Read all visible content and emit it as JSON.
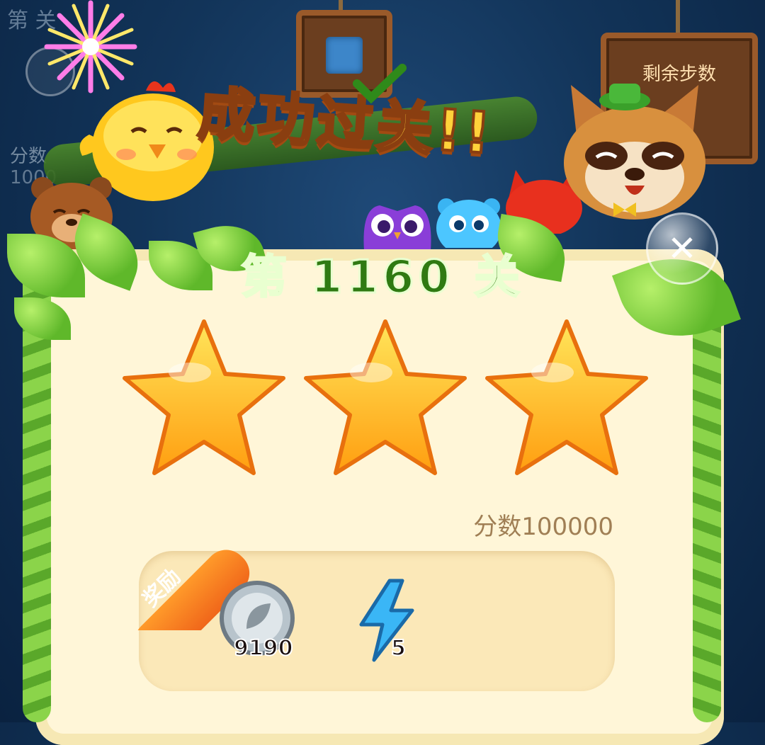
{
  "background": {
    "level_title": "第 关",
    "score_label": "分数",
    "score_value": "1000",
    "moves_label": "剩余步数"
  },
  "banner": {
    "text": "成功过关!!"
  },
  "dialog": {
    "level_title": "第 1160 关",
    "stars_earned": 3,
    "stars_total": 3,
    "score_text": "分数100000",
    "close_icon": "close-icon",
    "reward": {
      "label": "奖励",
      "items": [
        {
          "icon": "silver-coin-icon",
          "count": "9190"
        },
        {
          "icon": "lightning-icon",
          "count": "5"
        }
      ]
    }
  },
  "colors": {
    "accent_orange": "#f0661a",
    "star_gold": "#ffc21a",
    "title_green": "#2f7a12",
    "panel_cream": "#fff6d8"
  }
}
